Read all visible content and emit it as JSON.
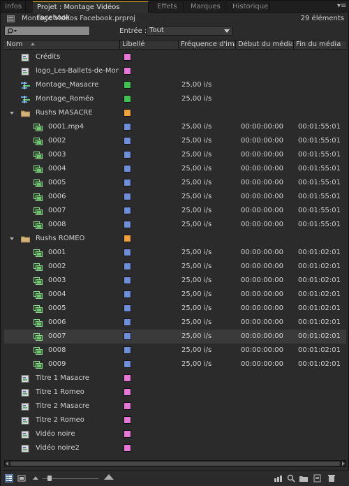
{
  "tabs": [
    {
      "label": "Infos",
      "active": false
    },
    {
      "label": "Projet : Montage Vidéos Facebook",
      "active": true
    },
    {
      "label": "Effets",
      "active": false
    },
    {
      "label": "Marques",
      "active": false
    },
    {
      "label": "Historique",
      "active": false
    }
  ],
  "project": {
    "name": "Montage Vidéos Facebook.prproj",
    "count": "29 éléments"
  },
  "search": {
    "placeholder": ""
  },
  "filter": {
    "label": "Entrée :",
    "value": "Tout"
  },
  "columns": {
    "name": "Nom",
    "label": "Libellé",
    "framerate": "Fréquence d'image",
    "media_start": "Début du média",
    "media_end": "Fin du média"
  },
  "colors": {
    "pink": "#e875d8",
    "green": "#3fc24f",
    "orange": "#f0a23a",
    "blue": "#6d8fd9",
    "accent": "#e8a72a"
  },
  "rows": [
    {
      "name": "Crédits",
      "kind": "graphic",
      "indent": 1,
      "color": "pink",
      "fps": "",
      "start": "",
      "end": ""
    },
    {
      "name": "logo_Les-Ballets-de-Monte",
      "kind": "graphic",
      "indent": 1,
      "color": "pink",
      "fps": "",
      "start": "",
      "end": ""
    },
    {
      "name": "Montage_Masacre",
      "kind": "sequence",
      "indent": 1,
      "color": "green",
      "fps": "25,00 i/s",
      "start": "",
      "end": ""
    },
    {
      "name": "Montage_Roméo",
      "kind": "sequence",
      "indent": 1,
      "color": "green",
      "fps": "25,00 i/s",
      "start": "",
      "end": ""
    },
    {
      "name": "Rushs MASACRE",
      "kind": "bin",
      "indent": 0,
      "color": "orange",
      "fps": "",
      "start": "",
      "end": ""
    },
    {
      "name": "0001.mp4",
      "kind": "clip",
      "indent": 2,
      "color": "blue",
      "fps": "25,00 i/s",
      "start": "00:00:00:00",
      "end": "00:01:55:01"
    },
    {
      "name": "0002",
      "kind": "clip",
      "indent": 2,
      "color": "blue",
      "fps": "25,00 i/s",
      "start": "00:00:00:00",
      "end": "00:01:55:01"
    },
    {
      "name": "0003",
      "kind": "clip",
      "indent": 2,
      "color": "blue",
      "fps": "25,00 i/s",
      "start": "00:00:00:00",
      "end": "00:01:55:01"
    },
    {
      "name": "0004",
      "kind": "clip",
      "indent": 2,
      "color": "blue",
      "fps": "25,00 i/s",
      "start": "00:00:00:00",
      "end": "00:01:55:01"
    },
    {
      "name": "0005",
      "kind": "clip",
      "indent": 2,
      "color": "blue",
      "fps": "25,00 i/s",
      "start": "00:00:00:00",
      "end": "00:01:55:01"
    },
    {
      "name": "0006",
      "kind": "clip",
      "indent": 2,
      "color": "blue",
      "fps": "25,00 i/s",
      "start": "00:00:00:00",
      "end": "00:01:55:01"
    },
    {
      "name": "0007",
      "kind": "clip",
      "indent": 2,
      "color": "blue",
      "fps": "25,00 i/s",
      "start": "00:00:00:00",
      "end": "00:01:55:01"
    },
    {
      "name": "0008",
      "kind": "clip",
      "indent": 2,
      "color": "blue",
      "fps": "25,00 i/s",
      "start": "00:00:00:00",
      "end": "00:01:55:01"
    },
    {
      "name": "Rushs ROMEO",
      "kind": "bin",
      "indent": 0,
      "color": "orange",
      "fps": "",
      "start": "",
      "end": ""
    },
    {
      "name": "0001",
      "kind": "clip",
      "indent": 2,
      "color": "blue",
      "fps": "25,00 i/s",
      "start": "00:00:00:00",
      "end": "00:01:02:01"
    },
    {
      "name": "0002",
      "kind": "clip",
      "indent": 2,
      "color": "blue",
      "fps": "25,00 i/s",
      "start": "00:00:00:00",
      "end": "00:01:02:01"
    },
    {
      "name": "0003",
      "kind": "clip",
      "indent": 2,
      "color": "blue",
      "fps": "25,00 i/s",
      "start": "00:00:00:00",
      "end": "00:01:02:01"
    },
    {
      "name": "0004",
      "kind": "clip",
      "indent": 2,
      "color": "blue",
      "fps": "25,00 i/s",
      "start": "00:00:00:00",
      "end": "00:01:02:01"
    },
    {
      "name": "0005",
      "kind": "clip",
      "indent": 2,
      "color": "blue",
      "fps": "25,00 i/s",
      "start": "00:00:00:00",
      "end": "00:01:02:01"
    },
    {
      "name": "0006",
      "kind": "clip",
      "indent": 2,
      "color": "blue",
      "fps": "25,00 i/s",
      "start": "00:00:00:00",
      "end": "00:01:02:01"
    },
    {
      "name": "0007",
      "kind": "clip",
      "indent": 2,
      "color": "blue",
      "fps": "25,00 i/s",
      "start": "00:00:00:00",
      "end": "00:01:02:01",
      "selected": true
    },
    {
      "name": "0008",
      "kind": "clip",
      "indent": 2,
      "color": "blue",
      "fps": "25,00 i/s",
      "start": "00:00:00:00",
      "end": "00:01:02:01"
    },
    {
      "name": "0009",
      "kind": "clip",
      "indent": 2,
      "color": "blue",
      "fps": "25,00 i/s",
      "start": "00:00:00:00",
      "end": "00:01:02:01"
    },
    {
      "name": "Titre 1 Masacre",
      "kind": "graphic",
      "indent": 1,
      "color": "pink",
      "fps": "",
      "start": "",
      "end": ""
    },
    {
      "name": "Titre 1 Romeo",
      "kind": "graphic",
      "indent": 1,
      "color": "pink",
      "fps": "",
      "start": "",
      "end": ""
    },
    {
      "name": "Titre 2 Masacre",
      "kind": "graphic",
      "indent": 1,
      "color": "pink",
      "fps": "",
      "start": "",
      "end": ""
    },
    {
      "name": "Titre 2 Romeo",
      "kind": "graphic",
      "indent": 1,
      "color": "pink",
      "fps": "",
      "start": "",
      "end": ""
    },
    {
      "name": "Vidéo noire",
      "kind": "graphic",
      "indent": 1,
      "color": "pink",
      "fps": "",
      "start": "",
      "end": ""
    },
    {
      "name": "Vidéo noire2",
      "kind": "graphic",
      "indent": 1,
      "color": "pink",
      "fps": "",
      "start": "",
      "end": ""
    }
  ],
  "toolbar": {
    "icons": [
      "list-view-icon",
      "icon-view-icon",
      "zoom-slider",
      "automate-to-sequence-icon",
      "find-icon",
      "new-bin-icon",
      "new-item-icon",
      "trash-icon"
    ]
  }
}
